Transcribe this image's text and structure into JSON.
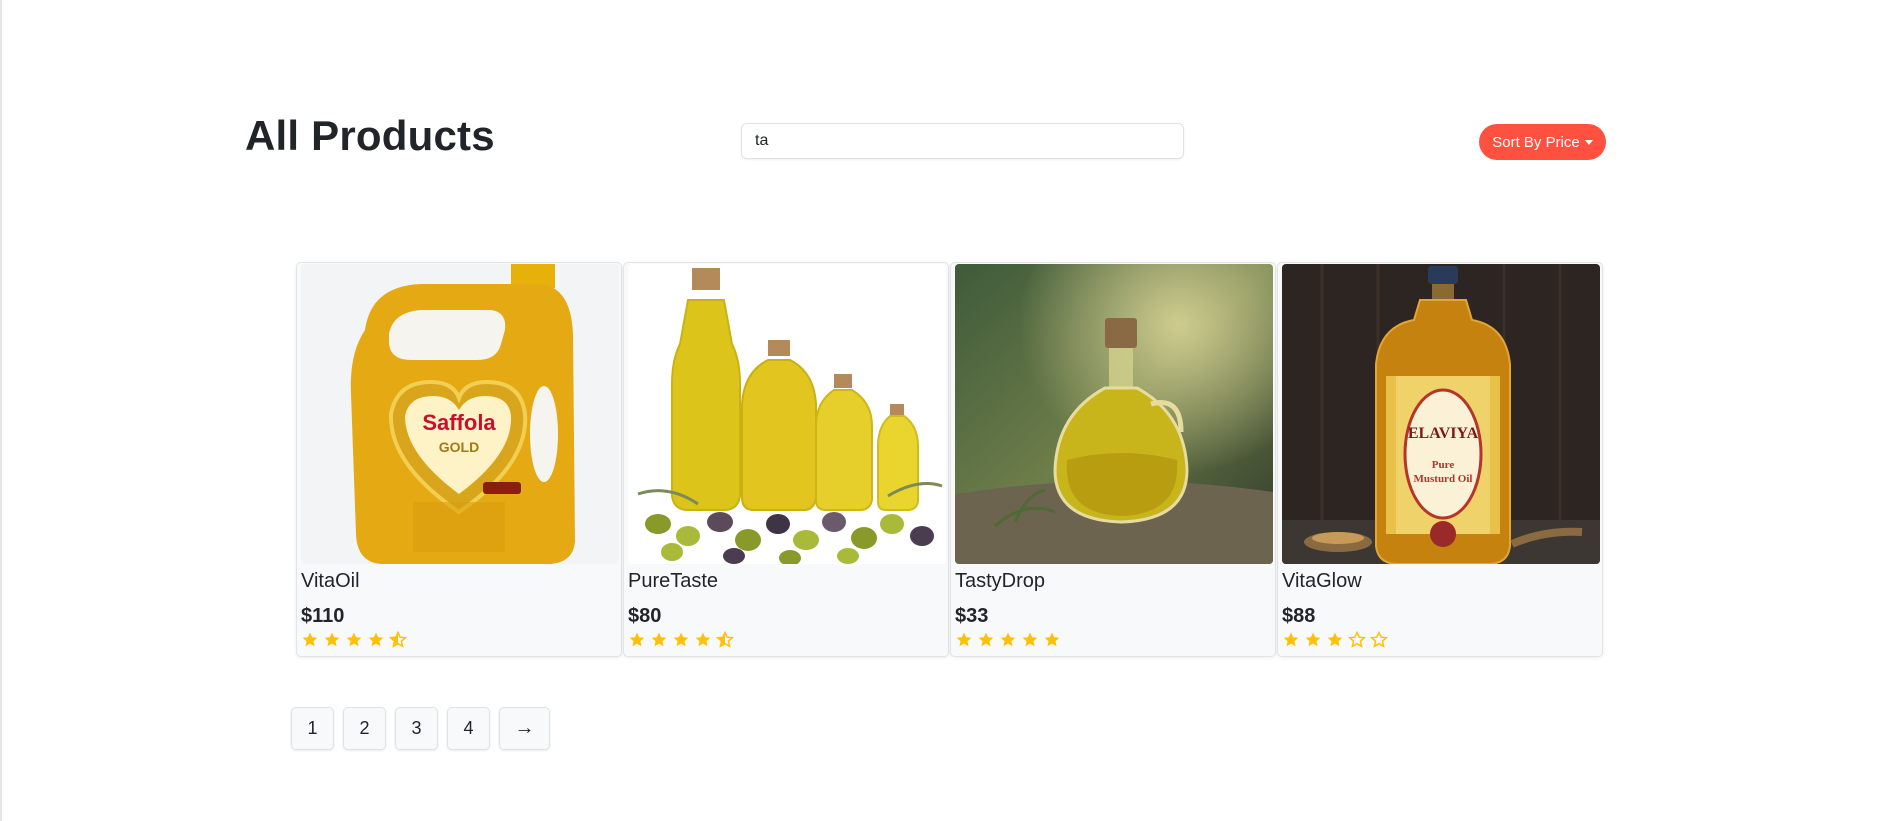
{
  "header": {
    "title": "All Products",
    "search_value": "ta",
    "sort_label": "Sort By Price"
  },
  "colors": {
    "accent": "#ff5040",
    "star": "#ffc107",
    "card_bg": "#f8f9fa"
  },
  "products": [
    {
      "name": "VitaOil",
      "price": "$110",
      "rating": 4.5,
      "image": "saffola-gold-jerrycan"
    },
    {
      "name": "PureTaste",
      "price": "$80",
      "rating": 4.5,
      "image": "olive-oil-bottles-with-olives"
    },
    {
      "name": "TastyDrop",
      "price": "$33",
      "rating": 5,
      "image": "olive-oil-jug"
    },
    {
      "name": "VitaGlow",
      "price": "$88",
      "rating": 3,
      "image": "elaviya-mustard-oil-bottle"
    }
  ],
  "pagination": {
    "pages": [
      "1",
      "2",
      "3",
      "4"
    ],
    "next_icon": "→"
  }
}
